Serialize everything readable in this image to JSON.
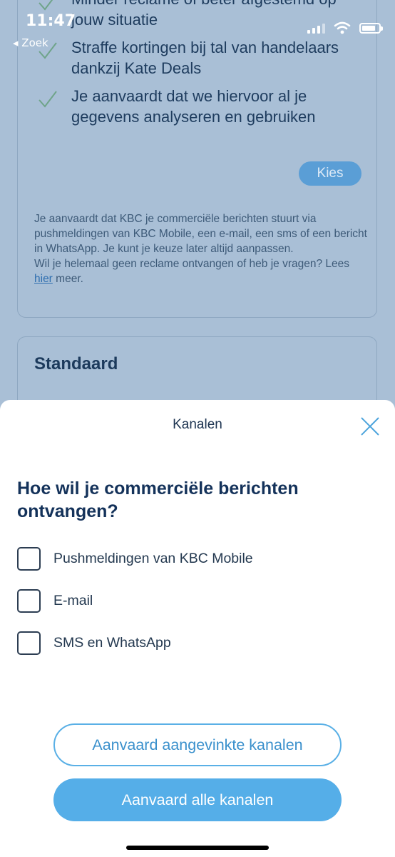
{
  "status_bar": {
    "time": "11:47",
    "back_label": "◂ Zoek",
    "icons": [
      "signal-icon",
      "wifi-icon",
      "battery-icon"
    ]
  },
  "background": {
    "features": [
      "Minder reclame of beter afgestemd op jouw situatie",
      "Straffe kortingen bij tal van handelaars dankzij Kate Deals",
      "Je aanvaardt dat we hiervoor al je gegevens analyseren en gebruiken"
    ],
    "kies_label": "Kies",
    "notice_text": "Je aanvaardt dat KBC je commerciële berichten stuurt via pushmeldingen van KBC Mobile, een e-mail, een sms of een bericht in WhatsApp. Je kunt je keuze later altijd aanpassen.",
    "notice_text2_pre": "Wil je helemaal geen reclame ontvangen of heb je vragen? Lees ",
    "notice_link": "hier",
    "notice_text2_post": " meer.",
    "card2_title": "Standaard"
  },
  "sheet": {
    "title": "Kanalen",
    "question": "Hoe wil je commerciële berichten ontvangen?",
    "options": [
      "Pushmeldingen van KBC Mobile",
      "E-mail",
      "SMS en WhatsApp"
    ],
    "accept_checked_label": "Aanvaard aangevinkte kanalen",
    "accept_all_label": "Aanvaard alle kanalen"
  },
  "colors": {
    "accent": "#55aee8",
    "title_navy": "#14325a",
    "overlay_bg": "#a9bfd6"
  }
}
